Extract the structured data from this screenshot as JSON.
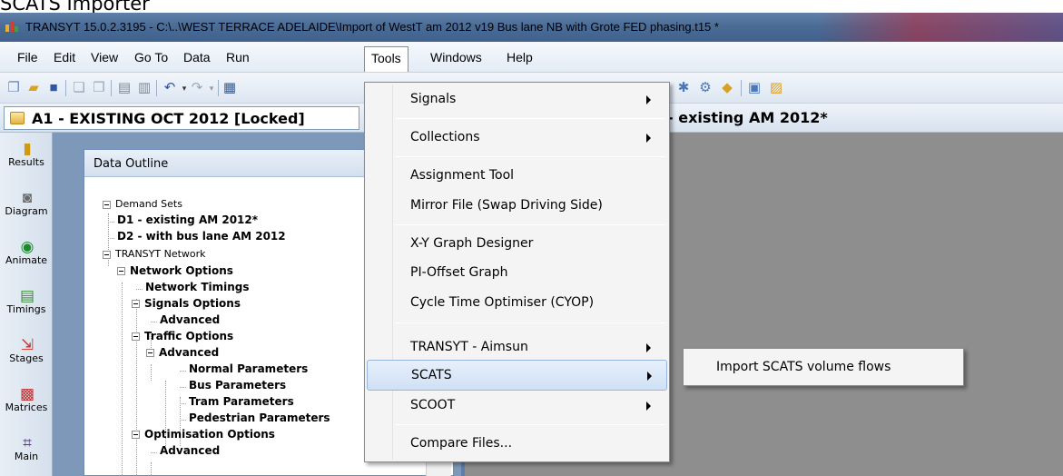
{
  "caption": "SCATS Importer",
  "window": {
    "title": "TRANSYT 15.0.2.3195 - C:\\..\\WEST TERRACE ADELAIDE\\Import of WestT am  2012 v19 Bus lane NB with Grote FED phasing.t15 *"
  },
  "menubar": {
    "items": [
      "File",
      "Edit",
      "View",
      "Go To",
      "Data",
      "Run",
      "Tools",
      "Windows",
      "Help"
    ],
    "open_item": "Tools"
  },
  "toolbar": {
    "icons": [
      "new-icon",
      "open-folder-icon",
      "save-icon",
      "copy-icon",
      "paste-icon",
      "print-icon",
      "print-preview-icon",
      "undo-icon",
      "redo-icon",
      "network-icon",
      "run-icon",
      "optimise-icon",
      "signal-icon",
      "report-icon",
      "export-icon"
    ]
  },
  "tabbar": {
    "analysis": "A1 - EXISTING OCT 2012 [Locked]",
    "demand_set": "- existing AM 2012*"
  },
  "leftbar": {
    "buttons": [
      {
        "label": "Results",
        "icon": "results-icon"
      },
      {
        "label": "Diagram",
        "icon": "diagram-icon"
      },
      {
        "label": "Animate",
        "icon": "animate-icon"
      },
      {
        "label": "Timings",
        "icon": "timings-icon"
      },
      {
        "label": "Stages",
        "icon": "stages-icon"
      },
      {
        "label": "Matrices",
        "icon": "matrices-icon"
      },
      {
        "label": "Main",
        "icon": "main-icon"
      }
    ]
  },
  "outline": {
    "title": "Data Outline",
    "tree": {
      "demand_sets": "Demand Sets",
      "d1": "D1 - existing AM 2012*",
      "d2": "D2 - with bus lane  AM 2012",
      "network": "TRANSYT Network",
      "network_options": "Network Options",
      "network_timings": "Network Timings",
      "signals_options": "Signals Options",
      "signals_advanced": "Advanced",
      "traffic_options": "Traffic Options",
      "traffic_advanced": "Advanced",
      "normal_params": "Normal Parameters",
      "bus_params": "Bus Parameters",
      "tram_params": "Tram Parameters",
      "ped_params": "Pedestrian Parameters",
      "opt_options": "Optimisation Options",
      "opt_advanced": "Advanced"
    }
  },
  "tools_menu": {
    "items": [
      {
        "label": "Signals",
        "submenu": true
      },
      {
        "label": "Collections",
        "submenu": true
      },
      {
        "label": "Assignment Tool",
        "submenu": false
      },
      {
        "label": "Mirror File (Swap Driving Side)",
        "submenu": false
      },
      {
        "label": "X-Y Graph Designer",
        "submenu": false
      },
      {
        "label": "PI-Offset Graph",
        "submenu": false
      },
      {
        "label": "Cycle Time Optimiser (CYOP)",
        "submenu": false
      },
      {
        "label": "TRANSYT - Aimsun",
        "submenu": true
      },
      {
        "label": "SCATS",
        "submenu": true,
        "highlighted": true
      },
      {
        "label": "SCOOT",
        "submenu": true
      },
      {
        "label": "Compare Files...",
        "submenu": false
      }
    ]
  },
  "scats_submenu": {
    "items": [
      "Import SCATS volume flows"
    ]
  },
  "colors": {
    "titlebar": "#4a6c96",
    "workspace": "#8e8e8e",
    "menu_highlight": "#cfe0f5"
  }
}
